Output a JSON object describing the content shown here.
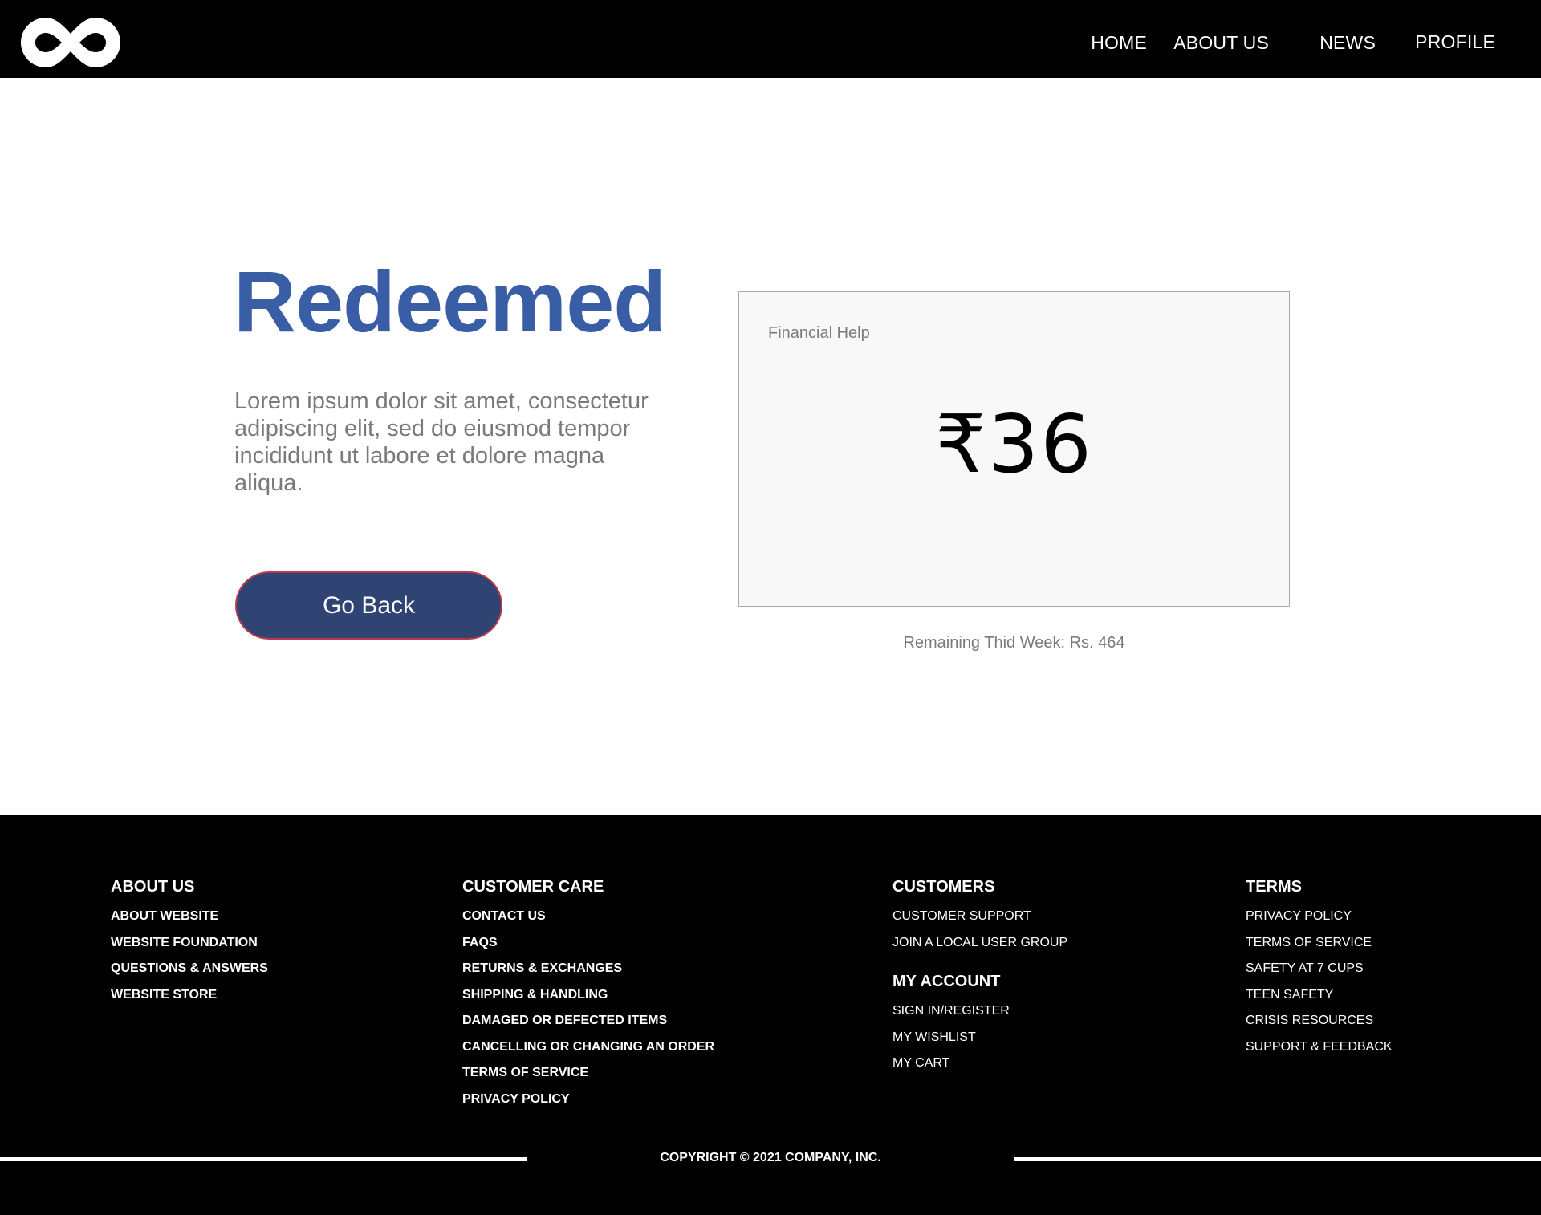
{
  "header": {
    "logo_icon": "infinity-icon",
    "nav": [
      {
        "label": "HOME"
      },
      {
        "label": "ABOUT US"
      },
      {
        "label": "NEWS"
      },
      {
        "label": "PROFILE"
      }
    ]
  },
  "main": {
    "title": "Redeemed",
    "description": "Lorem ipsum dolor sit amet, consectetur adipiscing elit, sed do eiusmod tempor incididunt ut labore et dolore magna aliqua.",
    "go_back_label": "Go Back",
    "card": {
      "label": "Financial Help",
      "amount": "₹36"
    },
    "remaining": "Remaining Thid Week: Rs. 464"
  },
  "footer": {
    "about": {
      "title": "ABOUT US",
      "items": [
        "ABOUT WEBSITE",
        "WEBSITE FOUNDATION",
        "QUESTIONS & ANSWERS",
        "WEBSITE STORE"
      ]
    },
    "customer_care": {
      "title": "CUSTOMER CARE",
      "items": [
        "CONTACT US",
        "FAQS",
        "RETURNS & EXCHANGES",
        "SHIPPING & HANDLING",
        "DAMAGED OR DEFECTED ITEMS",
        "CANCELLING OR CHANGING AN ORDER",
        "TERMS OF SERVICE",
        "PRIVACY POLICY"
      ]
    },
    "customers": {
      "title": "CUSTOMERS",
      "items": [
        "CUSTOMER SUPPORT",
        "JOIN A LOCAL USER GROUP"
      ]
    },
    "my_account": {
      "title": "MY ACCOUNT",
      "items": [
        "SIGN IN/REGISTER",
        "MY WISHLIST",
        "MY CART"
      ]
    },
    "terms": {
      "title": "TERMS",
      "items": [
        "PRIVACY POLICY",
        "TERMS OF SERVICE",
        "SAFETY AT 7 CUPS",
        "TEEN SAFETY",
        "CRISIS RESOURCES",
        "SUPPORT & FEEDBACK"
      ]
    },
    "copyright": "COPYRIGHT © 2021 COMPANY, INC."
  },
  "colors": {
    "header_bg": "#000000",
    "footer_bg": "#000000",
    "title": "#3a5ea6",
    "button_bg": "#2f4472",
    "button_border": "#b8394c",
    "muted_text": "#7a7a7a",
    "card_bg": "#f8f8f8"
  }
}
